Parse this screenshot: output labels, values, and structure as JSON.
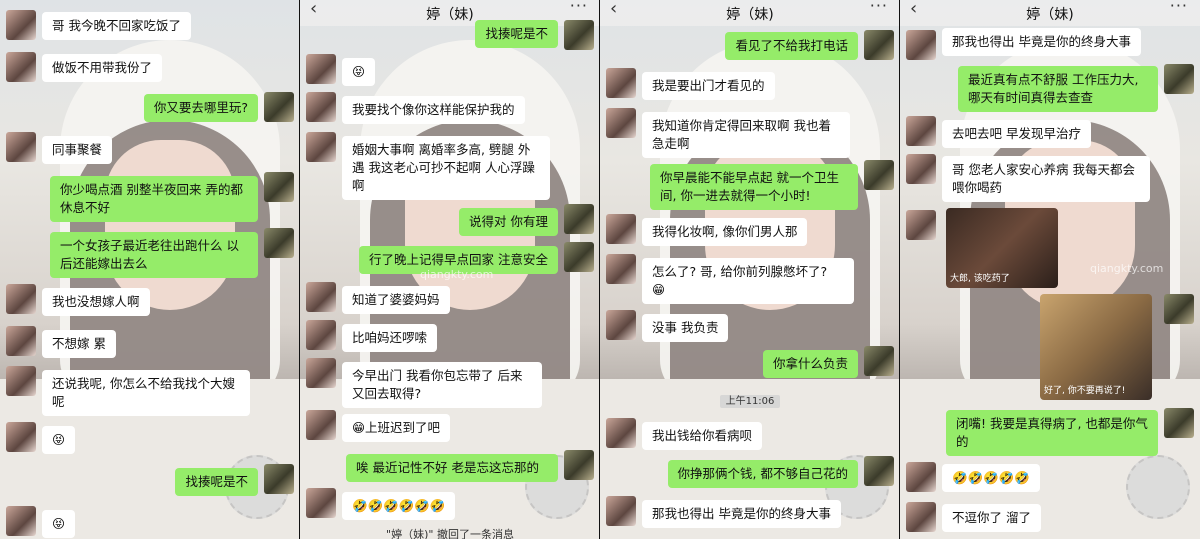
{
  "colors": {
    "bubble_right": "#95ec69",
    "bubble_left": "#ffffff",
    "topbar": "#ededed"
  },
  "icons": {
    "back": "‹",
    "more": "···"
  },
  "watermark": "qiangkty.com",
  "panels": [
    {
      "title": "",
      "messages": [
        {
          "side": "l",
          "text": "哥 我今晚不回家吃饭了"
        },
        {
          "side": "l",
          "text": "做饭不用带我份了"
        },
        {
          "side": "r",
          "text": "你又要去哪里玩?"
        },
        {
          "side": "l",
          "text": "同事聚餐"
        },
        {
          "side": "r",
          "text": "你少喝点酒 别整半夜回来 弄的都休息不好"
        },
        {
          "side": "r",
          "text": "一个女孩子最近老往出跑什么 以后还能嫁出去么"
        },
        {
          "side": "l",
          "text": "我也没想嫁人啊"
        },
        {
          "side": "l",
          "text": "不想嫁 累"
        },
        {
          "side": "l",
          "text": "还说我呢, 你怎么不给我找个大嫂呢"
        },
        {
          "side": "l",
          "text": "😝"
        },
        {
          "side": "r",
          "text": "找揍呢是不"
        },
        {
          "side": "l",
          "text": "😝"
        }
      ]
    },
    {
      "title": "婷（妹)",
      "messages": [
        {
          "side": "r",
          "text": "找揍呢是不"
        },
        {
          "side": "l",
          "text": "😝"
        },
        {
          "side": "l",
          "text": "我要找个像你这样能保护我的"
        },
        {
          "side": "l",
          "text": "婚姻大事啊 离婚率多高, 劈腿 外遇 我这老心可抄不起啊 人心浮躁啊"
        },
        {
          "side": "r",
          "text": "说得对 你有理"
        },
        {
          "side": "r",
          "text": "行了晚上记得早点回家 注意安全"
        },
        {
          "side": "l",
          "text": "知道了婆婆妈妈"
        },
        {
          "side": "l",
          "text": "比咱妈还啰嗦"
        },
        {
          "side": "l",
          "text": "今早出门 我看你包忘带了 后来又回去取得?"
        },
        {
          "side": "l",
          "text": "😁上班迟到了吧"
        },
        {
          "side": "r",
          "text": "唉 最近记性不好 老是忘这忘那的"
        },
        {
          "side": "l",
          "text": "🤣🤣🤣🤣🤣🤣"
        }
      ],
      "notice": "\"婷（妹)\" 撤回了一条消息"
    },
    {
      "title": "婷（妹)",
      "messages": [
        {
          "side": "r",
          "text": "看见了不给我打电话"
        },
        {
          "side": "l",
          "text": "我是要出门才看见的"
        },
        {
          "side": "l",
          "text": "我知道你肯定得回来取啊 我也着急走啊"
        },
        {
          "side": "r",
          "text": "你早晨能不能早点起 就一个卫生间, 你一进去就得一个小时!"
        },
        {
          "side": "l",
          "text": "我得化妆啊, 像你们男人那"
        },
        {
          "side": "l",
          "text": "怎么了? 哥, 给你前列腺憋坏了? 😁"
        },
        {
          "side": "l",
          "text": "没事 我负责"
        },
        {
          "side": "r",
          "text": "你拿什么负责"
        },
        {
          "side": "l",
          "text": "我出钱给你看病呗"
        },
        {
          "side": "r",
          "text": "你挣那俩个钱, 都不够自己花的"
        },
        {
          "side": "l",
          "text": "那我也得出 毕竟是你的终身大事"
        }
      ],
      "time": "上午11:06"
    },
    {
      "title": "婷（妹)",
      "messages": [
        {
          "side": "l",
          "text": "那我也得出 毕竟是你的终身大事"
        },
        {
          "side": "r",
          "text": "最近真有点不舒服 工作压力大, 哪天有时间真得去查查"
        },
        {
          "side": "l",
          "text": "去吧去吧 早发现早治疗"
        },
        {
          "side": "l",
          "text": "哥 您老人家安心养病 我每天都会喂你喝药"
        },
        {
          "side": "r",
          "text": "闭嘴! 我要是真得病了, 也都是你气的"
        },
        {
          "side": "l",
          "text": "🤣🤣🤣🤣🤣"
        },
        {
          "side": "l",
          "text": "不逗你了 溜了"
        }
      ],
      "images": [
        {
          "caption": "大郎, 该吃药了"
        },
        {
          "caption": "好了, 你不要再说了!"
        }
      ]
    }
  ]
}
